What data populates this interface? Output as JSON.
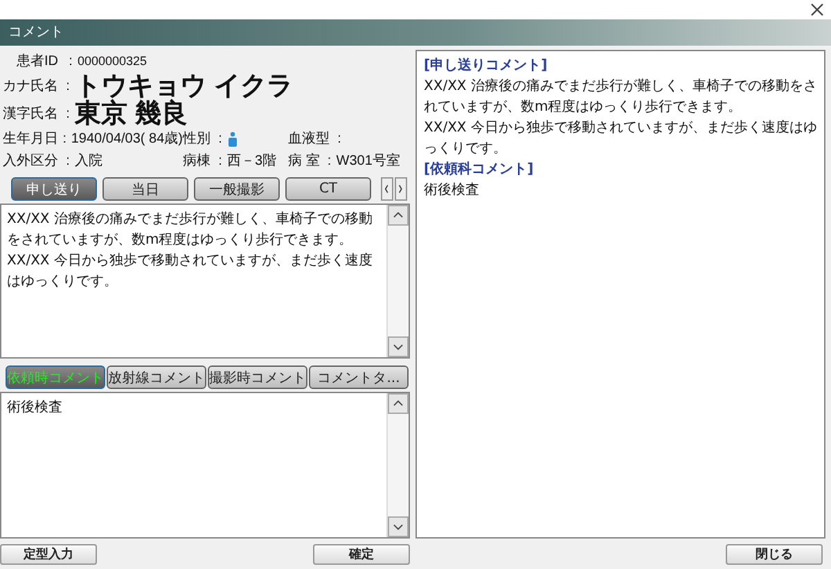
{
  "window": {
    "title": "コメント"
  },
  "patient": {
    "rows": [
      [
        {
          "kind": "text",
          "label": "患者ID",
          "sep": ":",
          "value": "0000000325"
        }
      ],
      [
        {
          "kind": "large",
          "label": "カナ氏名",
          "sep": ":",
          "value": "トウキョウ イクラ"
        }
      ],
      [
        {
          "kind": "large",
          "label": "漢字氏名",
          "sep": ":",
          "value": "東京 幾良"
        }
      ],
      [
        {
          "kind": "text",
          "label": "生年月日",
          "sep": ":",
          "value": "1940/04/03( 84歳)"
        },
        {
          "kind": "gender",
          "label": "性別",
          "sep": ":"
        },
        {
          "kind": "text",
          "label": "血液型",
          "sep": ":"
        }
      ],
      [
        {
          "kind": "text",
          "label": "入外区分",
          "sep": ":",
          "value": "入院"
        },
        {
          "kind": "text",
          "label": "病棟",
          "sep": ":",
          "value": "西－3階"
        },
        {
          "kind": "text",
          "label": "病 室",
          "sep": ":",
          "value": "W301号室"
        }
      ]
    ]
  },
  "tabs": [
    {
      "label": "申し送り",
      "selected": true
    },
    {
      "label": "当日",
      "selected": false
    },
    {
      "label": "一般撮影",
      "selected": false
    },
    {
      "label": "CT",
      "selected": false
    }
  ],
  "memo": {
    "lines": [
      "XX/XX 治療後の痛みでまだ歩行が難しく、車椅子での移動をされていますが、数m程度はゆっくり歩行できます。",
      "XX/XX 今日から独歩で移動されていますが、まだ歩く速度はゆっくりです。"
    ]
  },
  "sub_tabs": [
    {
      "label": "依頼時コメント",
      "selected": true
    },
    {
      "label": "放射線コメント",
      "selected": false
    },
    {
      "label": "撮影時コメント",
      "selected": false
    },
    {
      "label": "コメントタ...",
      "selected": false
    }
  ],
  "sub_memo": {
    "lines": [
      "術後検査"
    ]
  },
  "summary": [
    {
      "heading": "[申し送りコメント]",
      "lines": [
        "XX/XX 治療後の痛みでまだ歩行が難しく、車椅子での移動をされていますが、数m程度はゆっくり歩行できます。",
        "XX/XX 今日から独歩で移動されていますが、まだ歩く速度はゆっくりです。"
      ]
    },
    {
      "heading": "[依頼科コメント]",
      "lines": [
        "術後検査"
      ]
    }
  ],
  "footer_left": [
    "定型入力",
    "確定"
  ],
  "footer_right": [
    "閉じる"
  ]
}
